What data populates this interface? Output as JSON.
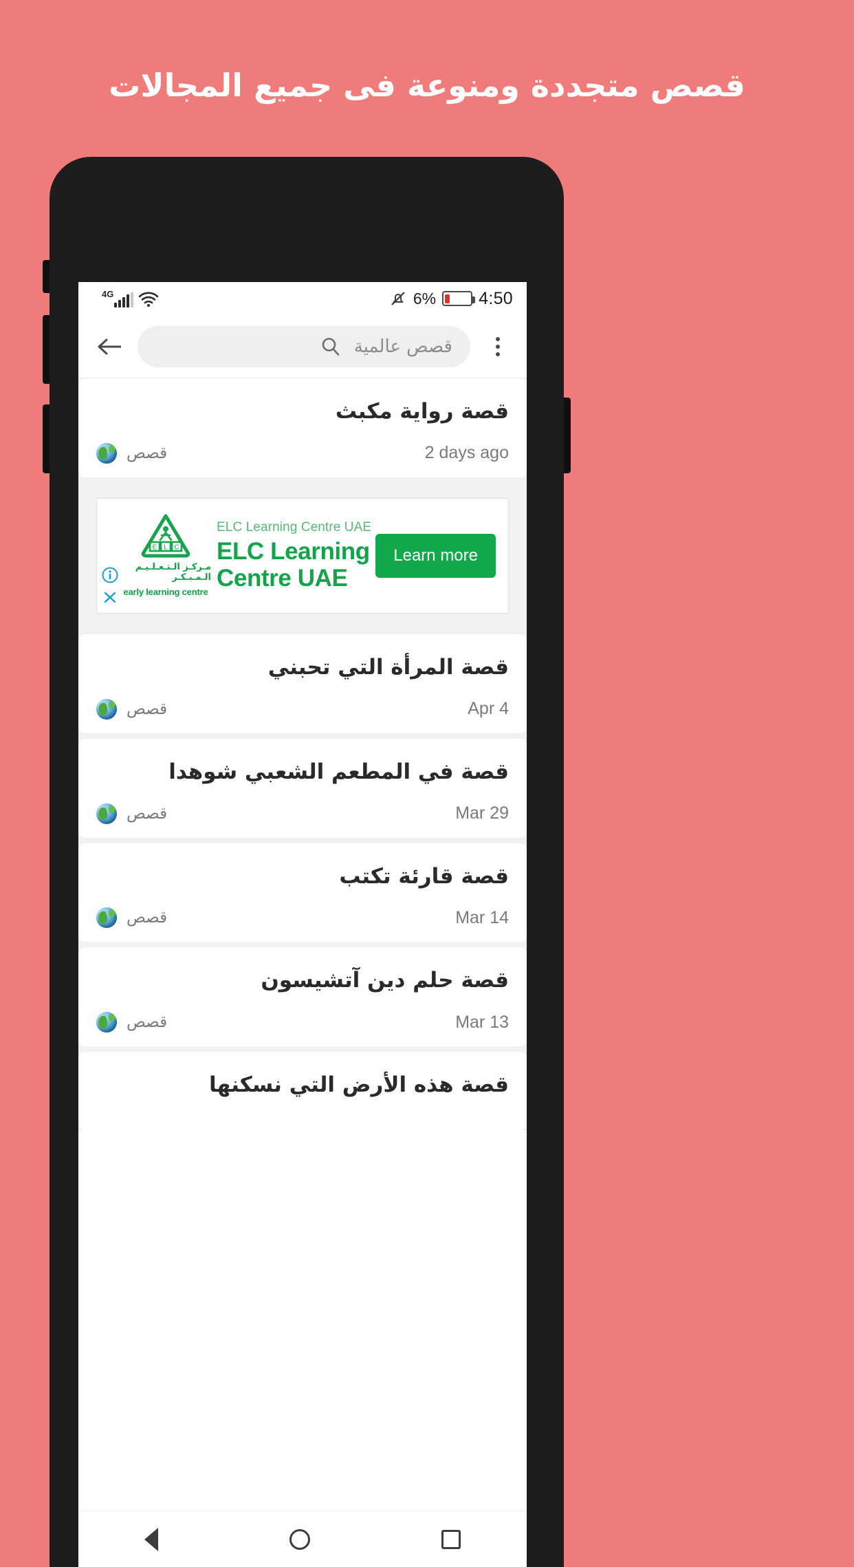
{
  "promo": {
    "headline": "قصص متجددة ومنوعة فى جميع المجالات",
    "background_color": "#ef7b7b",
    "text_color": "#ffffff"
  },
  "statusbar": {
    "network_type": "4G",
    "signal_icon": "signal-bars-icon",
    "wifi_icon": "wifi-icon",
    "silent_icon": "bell-muted-icon",
    "battery_percent": "6%",
    "battery_icon": "battery-low-icon",
    "clock": "4:50"
  },
  "toolbar": {
    "back_icon": "back-arrow-icon",
    "search_icon": "search-icon",
    "search_value": "قصص عالمية",
    "overflow_icon": "more-vertical-icon"
  },
  "stories": [
    {
      "title": "قصة رواية مكبث",
      "source": "قصص",
      "date": "2 days ago",
      "source_icon": "globe-icon"
    },
    {
      "title": "قصة المرأة التي تحبني",
      "source": "قصص",
      "date": "Apr 4",
      "source_icon": "globe-icon"
    },
    {
      "title": "قصة في المطعم الشعبي شوهدا",
      "source": "قصص",
      "date": "Mar 29",
      "source_icon": "globe-icon"
    },
    {
      "title": "قصة قارئة تكتب",
      "source": "قصص",
      "date": "Mar 14",
      "source_icon": "globe-icon"
    },
    {
      "title": "قصة حلم دين آتشيسون",
      "source": "قصص",
      "date": "Mar 13",
      "source_icon": "globe-icon"
    },
    {
      "title": "قصة هذه الأرض التي نسكنها",
      "source": "",
      "date": "",
      "source_icon": "globe-icon"
    }
  ],
  "ad": {
    "kicker": "ELC Learning Centre UAE",
    "headline": "ELC Learning Centre UAE",
    "cta_label": "Learn more",
    "logo_arabic": "مـركـز الـتـعـلـيـم الـمـبـكـر",
    "logo_english": "early learning centre",
    "logo_letters": "E L C",
    "info_icon": "ad-info-icon",
    "close_icon": "ad-close-icon",
    "brand_color": "#12a84c",
    "kicker_color": "#5ab777"
  },
  "navbar": {
    "back_icon": "nav-back-triangle-icon",
    "home_icon": "nav-home-circle-icon",
    "recents_icon": "nav-recents-square-icon"
  }
}
